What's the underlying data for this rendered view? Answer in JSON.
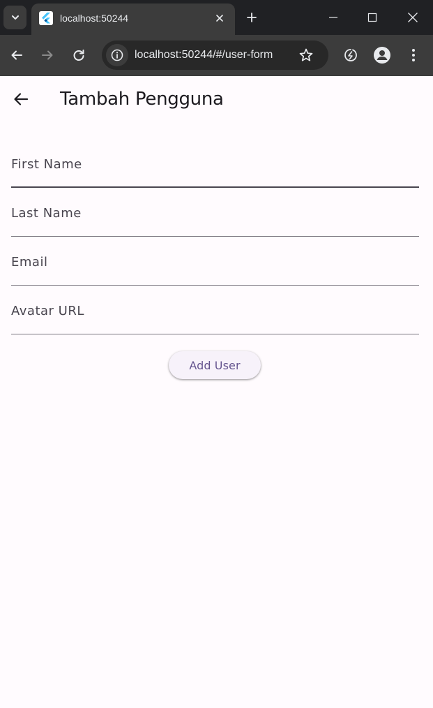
{
  "browser": {
    "tab_title": "localhost:50244",
    "url": "localhost:50244/#/user-form",
    "icons": {
      "tab_search": "chevron-down-icon",
      "favicon": "flutter-logo-icon",
      "tab_close": "close-icon",
      "new_tab": "plus-icon",
      "minimize": "minimize-icon",
      "maximize": "maximize-icon",
      "window_close": "close-icon",
      "back": "arrow-left-icon",
      "forward": "arrow-right-icon",
      "reload": "reload-icon",
      "site_info": "info-icon",
      "bookmark": "star-icon",
      "extension": "leaf-icon",
      "profile": "account-icon",
      "menu": "more-vert-icon"
    },
    "colors": {
      "tabstrip_bg": "#202124",
      "toolbar_bg": "#3c3c3c",
      "omnibox_bg": "#282828"
    }
  },
  "app": {
    "title": "Tambah Pengguna",
    "back_icon": "arrow-left-icon",
    "form": {
      "fields": [
        {
          "label": "First Name",
          "value": ""
        },
        {
          "label": "Last Name",
          "value": ""
        },
        {
          "label": "Email",
          "value": ""
        },
        {
          "label": "Avatar URL",
          "value": ""
        }
      ],
      "submit_label": "Add User"
    },
    "colors": {
      "background": "#fffbfe",
      "button_text": "#65558f",
      "button_bg": "#f7f2fa"
    }
  }
}
